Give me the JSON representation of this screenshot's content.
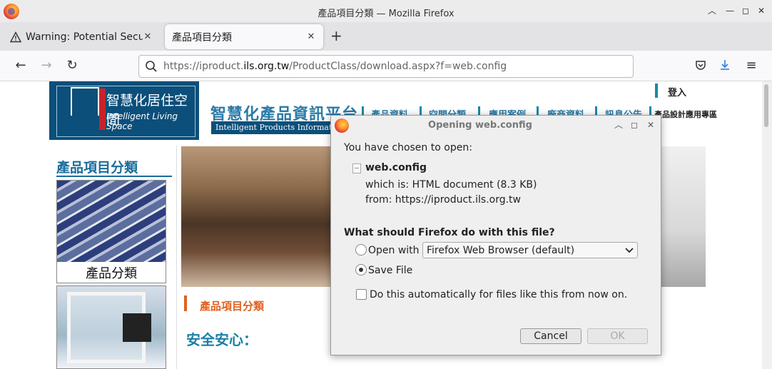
{
  "window": {
    "title": "產品項目分類 — Mozilla Firefox"
  },
  "tabs": [
    {
      "label": "Warning: Potential Securi",
      "icon": "warning-icon"
    },
    {
      "label": "產品項目分類"
    }
  ],
  "toolbar": {
    "url_prefix": "https://iproduct.",
    "url_domain": "ils.org.tw",
    "url_path": "/ProductClass/download.aspx?f=web.config"
  },
  "site": {
    "logo_cn": "智慧化居住空間",
    "logo_en": "Intelligent Living Space",
    "title": "智慧化產品資訊平台",
    "subtitle": "Intelligent Products Information Sy",
    "login": "登入",
    "menu": [
      "產品資料",
      "空間分類",
      "應用案例",
      "廠商資料",
      "訊息公告",
      "產品設計應用專區"
    ],
    "sidebar_title": "產品項目分類",
    "card_label": "產品分類",
    "section_title": "產品項目分類",
    "section_heading": "安全安心："
  },
  "dialog": {
    "title": "Opening web.config",
    "intro": "You have chosen to open:",
    "filename": "web.config",
    "which_is": "which is:  HTML document (8.3 KB)",
    "from": "from:  https://iproduct.ils.org.tw",
    "question": "What should Firefox do with this file?",
    "open_with_label": "Open with",
    "open_with_value": "Firefox Web Browser (default)",
    "save_file_label": "Save File",
    "auto_label": "Do this automatically for files like this from now on.",
    "selected_action": "Save File",
    "cancel": "Cancel",
    "ok": "OK"
  }
}
